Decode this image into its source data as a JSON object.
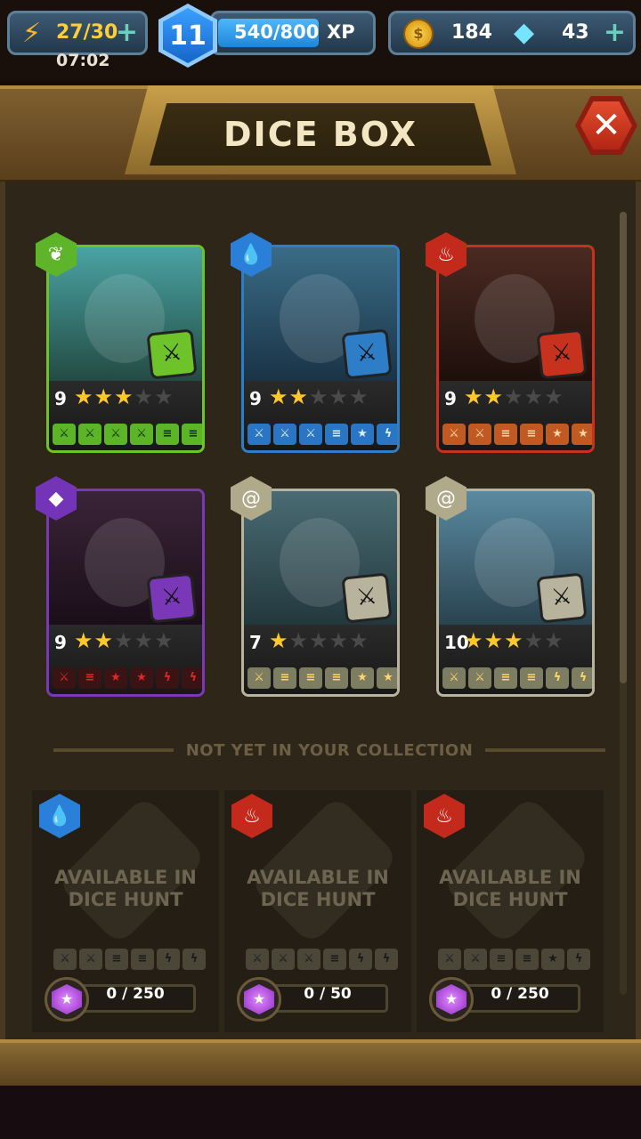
{
  "hud": {
    "energy": {
      "value": "27/30",
      "timer": "07:02",
      "icon": "lightning-icon",
      "plus_icon": "plus-icon"
    },
    "level": {
      "value": "11"
    },
    "xp": {
      "value": "540/800",
      "unit": "XP",
      "progress": 0.675
    },
    "coins": {
      "value": "184",
      "icon": "coin-icon"
    },
    "gems": {
      "value": "43",
      "icon": "diamond-icon"
    }
  },
  "title": "DICE BOX",
  "close_icon": "close-icon",
  "owned_dice": [
    {
      "element": "nature",
      "color": "#6ec32a",
      "level": "9",
      "stars": 3,
      "max_stars": 5,
      "faces": [
        "sword",
        "sword",
        "sword",
        "sword",
        "shield",
        "shield"
      ]
    },
    {
      "element": "water",
      "color": "#2d7ec7",
      "level": "9",
      "stars": 2,
      "max_stars": 5,
      "faces": [
        "sword",
        "sword",
        "sword",
        "shield",
        "star",
        "lightning"
      ]
    },
    {
      "element": "fire",
      "color": "#c7321e",
      "level": "9",
      "stars": 2,
      "max_stars": 5,
      "faces": [
        "sword",
        "sword",
        "shield",
        "shield",
        "star",
        "star"
      ]
    },
    {
      "element": "shadow",
      "color": "#7a38b8",
      "level": "9",
      "stars": 2,
      "max_stars": 5,
      "faces": [
        "sword",
        "shield",
        "star",
        "star",
        "lightning",
        "lightning"
      ]
    },
    {
      "element": "neutral",
      "color": "#b8b39c",
      "level": "7",
      "stars": 1,
      "max_stars": 5,
      "faces": [
        "sword",
        "shield",
        "shield",
        "shield",
        "star",
        "star"
      ]
    },
    {
      "element": "neutral",
      "color": "#b8b39c",
      "level": "10",
      "stars": 3,
      "max_stars": 5,
      "faces": [
        "sword",
        "sword",
        "shield",
        "shield",
        "lightning",
        "lightning"
      ]
    }
  ],
  "divider_text": "NOT YET IN YOUR COLLECTION",
  "locked_dice": [
    {
      "element": "water",
      "message_line1": "AVAILABLE IN",
      "message_line2": "DICE HUNT",
      "progress": "0 / 250"
    },
    {
      "element": "fire",
      "message_line1": "AVAILABLE IN",
      "message_line2": "DICE HUNT",
      "progress": "0 / 50"
    },
    {
      "element": "fire",
      "message_line1": "AVAILABLE IN",
      "message_line2": "DICE HUNT",
      "progress": "0 / 250"
    }
  ]
}
